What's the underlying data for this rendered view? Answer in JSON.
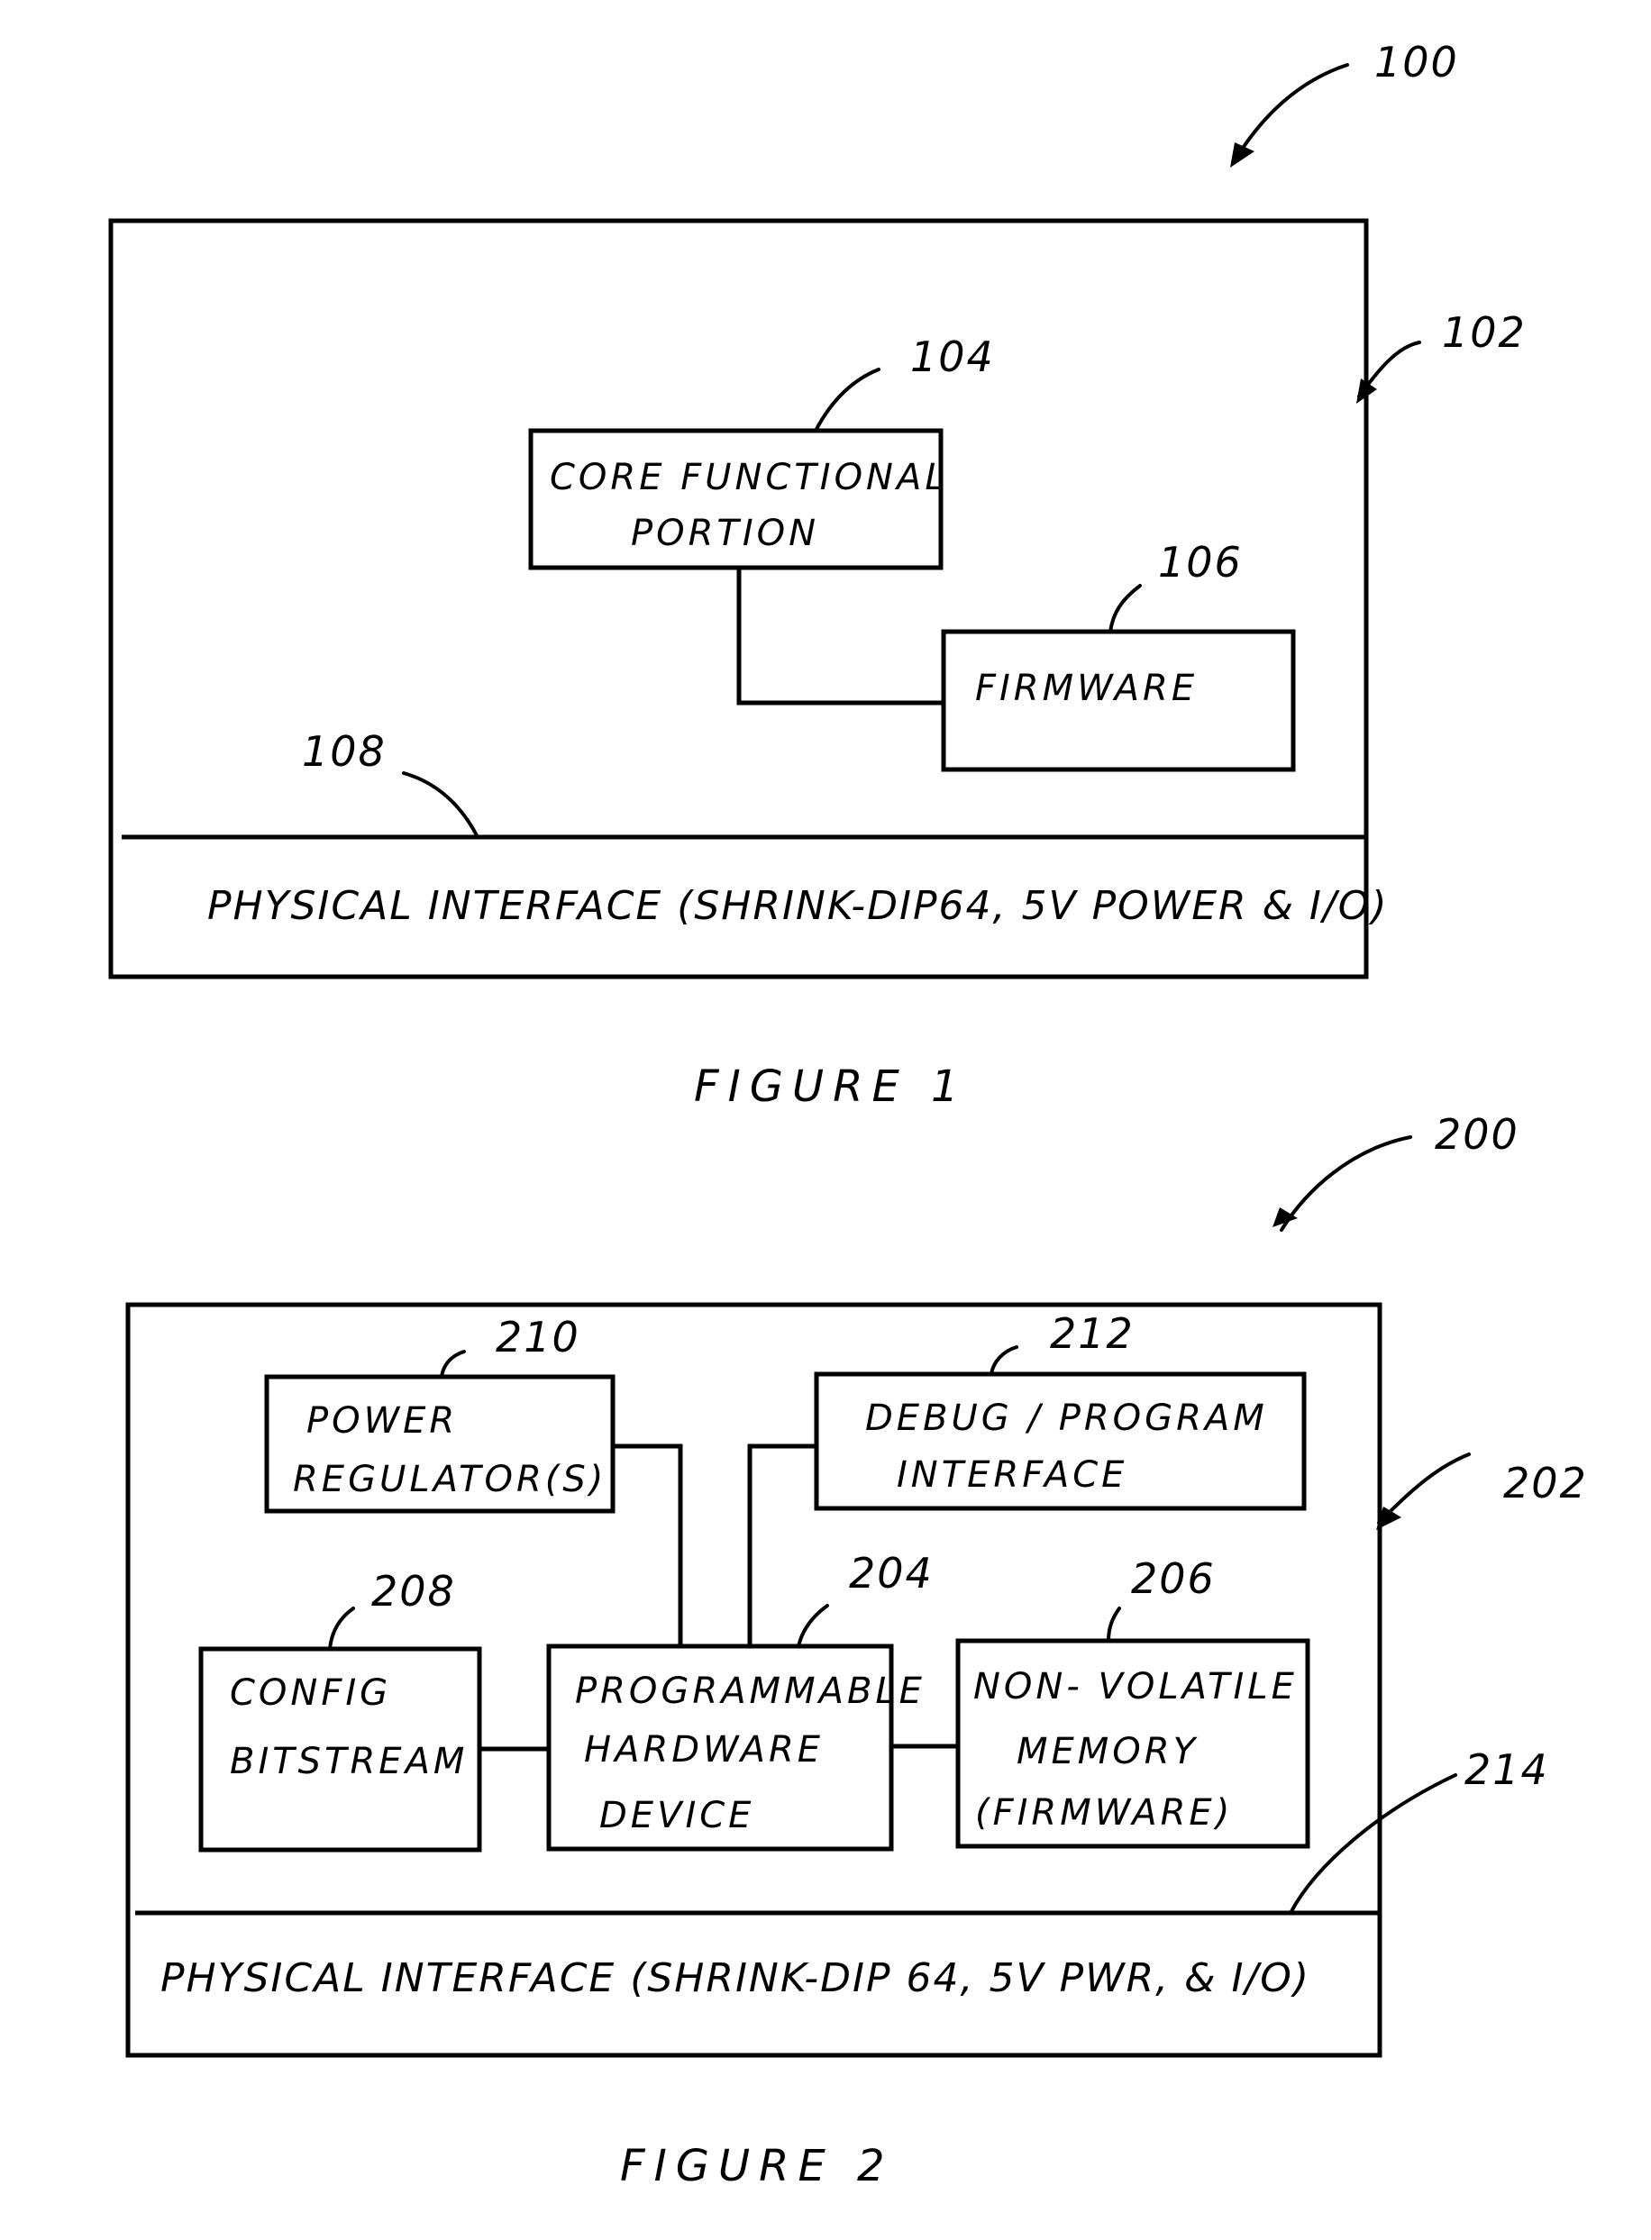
{
  "figure1": {
    "ref": "100",
    "caption": "FIGURE 1",
    "module": {
      "ref": "102"
    },
    "blocks": [
      {
        "ref": "104",
        "lines": [
          "CORE  FUNCTIONAL",
          "PORTION"
        ]
      },
      {
        "ref": "106",
        "lines": [
          "FIRMWARE"
        ]
      }
    ],
    "interface": {
      "ref": "108",
      "label": "PHYSICAL INTERFACE (SHRINK-DIP64, 5V POWER & I/O)"
    },
    "connections": [
      [
        "104",
        "106"
      ]
    ]
  },
  "figure2": {
    "ref": "200",
    "caption": "FIGURE 2",
    "module": {
      "ref": "202"
    },
    "blocks": [
      {
        "ref": "210",
        "lines": [
          "POWER",
          "REGULATOR(S)"
        ]
      },
      {
        "ref": "212",
        "lines": [
          "DEBUG / PROGRAM",
          "INTERFACE"
        ]
      },
      {
        "ref": "208",
        "lines": [
          "CONFIG",
          "BITSTREAM"
        ]
      },
      {
        "ref": "204",
        "lines": [
          "PROGRAMMABLE",
          "HARDWARE",
          "DEVICE"
        ]
      },
      {
        "ref": "206",
        "lines": [
          "NON- VOLATILE",
          "MEMORY",
          "(FIRMWARE)"
        ]
      }
    ],
    "interface": {
      "ref": "214",
      "label": "PHYSICAL INTERFACE (SHRINK-DIP 64, 5V PWR, & I/O)"
    },
    "connections": [
      [
        "210",
        "204"
      ],
      [
        "212",
        "204"
      ],
      [
        "208",
        "204"
      ],
      [
        "204",
        "206"
      ]
    ]
  }
}
